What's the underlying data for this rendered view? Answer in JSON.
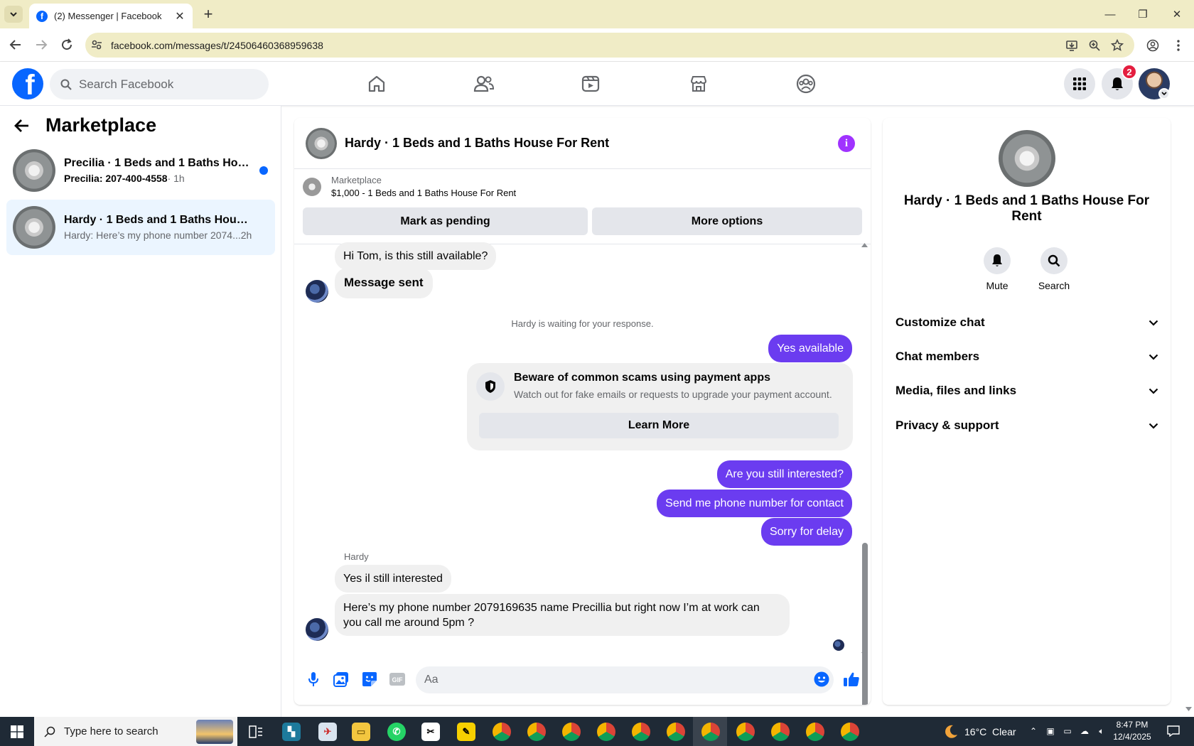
{
  "browser": {
    "tab_title": "(2) Messenger | Facebook",
    "url": "facebook.com/messages/t/24506460368959638"
  },
  "fb_header": {
    "search_placeholder": "Search Facebook",
    "notification_count": "2",
    "nav_icons": [
      "home-icon",
      "friends-icon",
      "video-icon",
      "marketplace-icon",
      "groups-icon"
    ]
  },
  "sidebar": {
    "title": "Marketplace",
    "conversations": [
      {
        "name": "Precilia · 1 Beds and 1 Baths Hou...",
        "snippet": "Precilia: 207-400-4558",
        "time": " · 1h",
        "unread": true
      },
      {
        "name": "Hardy · 1 Beds and 1 Baths House ...",
        "snippet": "Hardy: Here’s my phone number 2074...",
        "time": " 2h",
        "unread": false
      }
    ]
  },
  "chat": {
    "title": "Hardy · 1 Beds and 1 Baths House For Rent",
    "listing": {
      "label": "Marketplace",
      "title": "$1,000 - 1 Beds and 1 Baths House For Rent"
    },
    "actions": {
      "pending": "Mark as pending",
      "more": "More options"
    },
    "messages": {
      "m1": "Hi Tom, is this still available?",
      "m2": "Message sent",
      "waiting": "Hardy is waiting for your response.",
      "out1": "Yes available",
      "out2": "Are you still interested?",
      "out3": "Send me phone number for contact",
      "out4": "Sorry for delay",
      "sender": "Hardy",
      "in1": "Yes il still interested",
      "in2": "Here’s my phone number 2079169635 name Precillia but right now I’m at work can you call me around 5pm ?"
    },
    "scam_card": {
      "title": "Beware of common scams using payment apps",
      "desc": "Watch out for fake emails or requests to upgrade your payment account.",
      "button": "Learn More"
    },
    "composer_placeholder": "Aa"
  },
  "right_panel": {
    "title": "Hardy · 1 Beds and 1 Baths House For Rent",
    "mute": "Mute",
    "search": "Search",
    "sections": [
      "Customize chat",
      "Chat members",
      "Media, files and links",
      "Privacy & support"
    ]
  },
  "taskbar": {
    "search_placeholder": "Type here to search",
    "weather": "16°C  Clear",
    "time": "8:47 PM",
    "date": "12/4/2025"
  },
  "colors": {
    "fb_blue": "#0866ff",
    "outgoing_bubble": "#6b3cf0",
    "info_purple": "#a033ff",
    "badge_red": "#e41e3f"
  }
}
